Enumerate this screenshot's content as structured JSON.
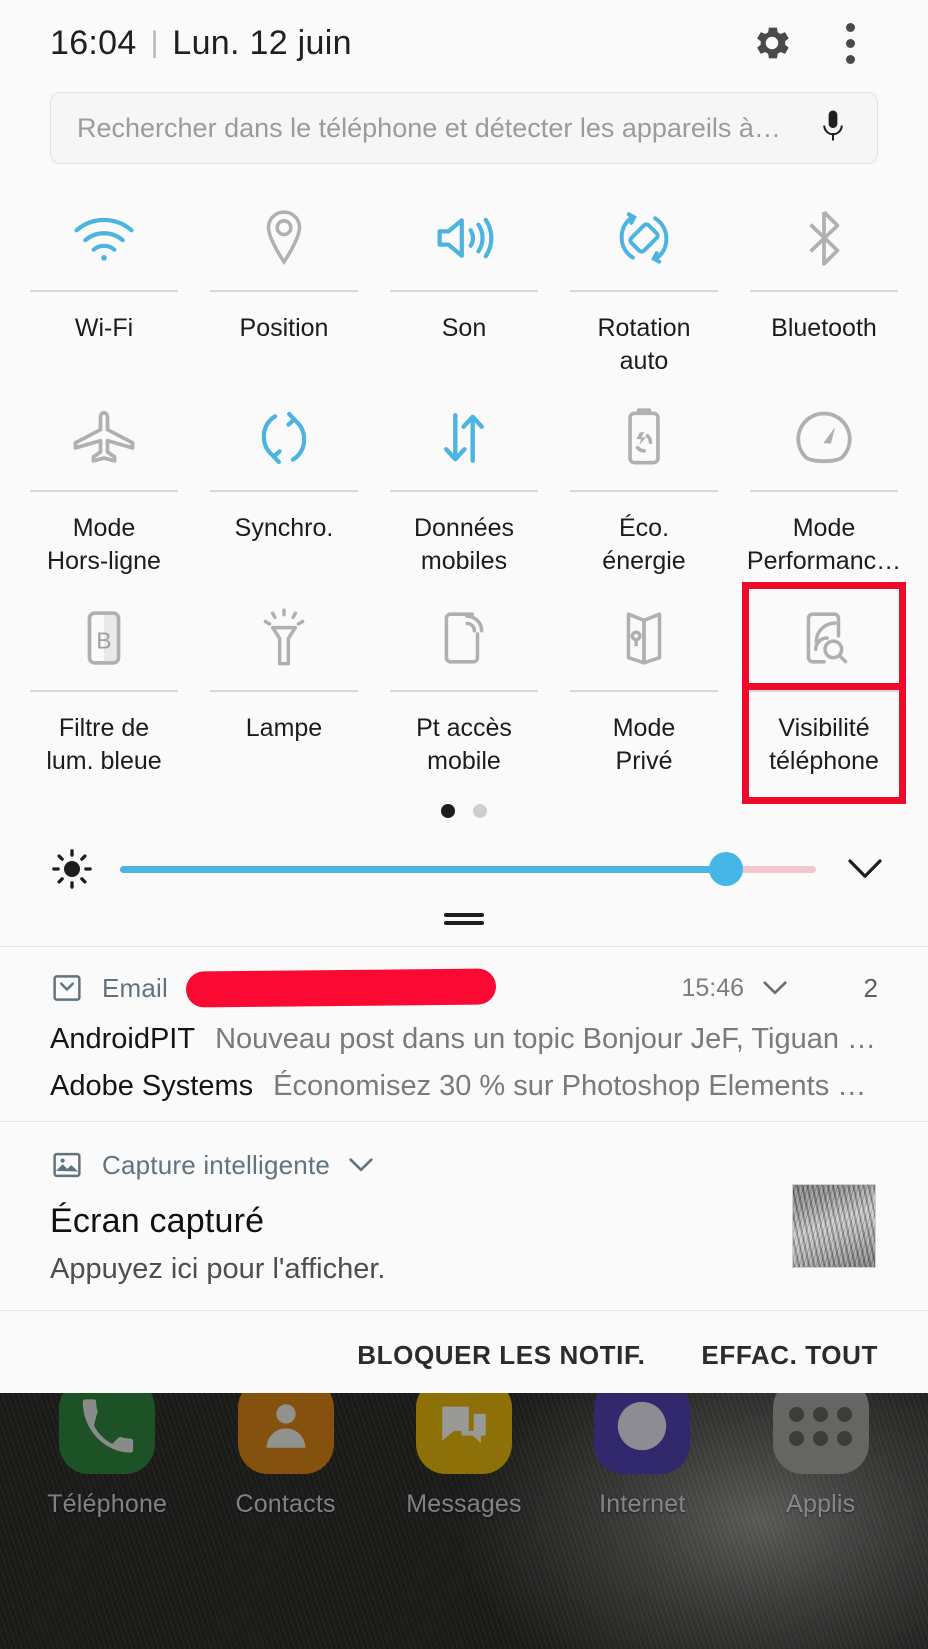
{
  "status": {
    "time": "16:04",
    "separator": "|",
    "date": "Lun. 12 juin",
    "settings_icon": "gear-icon",
    "overflow_icon": "kebab-menu-icon"
  },
  "search": {
    "placeholder": "Rechercher dans le téléphone et détecter les appareils à…",
    "mic_icon": "microphone-icon"
  },
  "quick_settings": {
    "accent_on": "#4db3e0",
    "accent_off": "#b0b0b0",
    "rows": [
      [
        {
          "label": "Wi-Fi",
          "icon": "wifi-icon",
          "active": true
        },
        {
          "label": "Position",
          "icon": "location-pin-icon",
          "active": false
        },
        {
          "label": "Son",
          "icon": "volume-speaker-icon",
          "active": true
        },
        {
          "label": "Rotation\nauto",
          "icon": "auto-rotate-icon",
          "active": true
        },
        {
          "label": "Bluetooth",
          "icon": "bluetooth-icon",
          "active": false
        }
      ],
      [
        {
          "label": "Mode\nHors-ligne",
          "icon": "airplane-icon",
          "active": false
        },
        {
          "label": "Synchro.",
          "icon": "sync-icon",
          "active": true
        },
        {
          "label": "Données\nmobiles",
          "icon": "data-arrows-icon",
          "active": true
        },
        {
          "label": "Éco.\nénergie",
          "icon": "battery-saver-icon",
          "active": false
        },
        {
          "label": "Mode\nPerformanc…",
          "icon": "performance-gauge-icon",
          "active": false
        }
      ],
      [
        {
          "label": "Filtre de\nlum. bleue",
          "icon": "blue-light-filter-icon",
          "active": false
        },
        {
          "label": "Lampe",
          "icon": "flashlight-icon",
          "active": false
        },
        {
          "label": "Pt accès\nmobile",
          "icon": "mobile-hotspot-icon",
          "active": false
        },
        {
          "label": "Mode\nPrivé",
          "icon": "private-mode-icon",
          "active": false
        },
        {
          "label": "Visibilité\ntéléphone",
          "icon": "phone-visibility-icon",
          "active": false,
          "highlighted": true
        }
      ]
    ],
    "pages": {
      "total": 2,
      "current": 1
    }
  },
  "brightness": {
    "icon": "brightness-icon",
    "value_percent": 87,
    "expand_icon": "chevron-down-icon",
    "fill_color": "#4db3e0",
    "track_color": "#f3c7ce"
  },
  "annotation": {
    "color": "#ee0a2a",
    "target": "Visibilité téléphone"
  },
  "notifications": {
    "email_group": {
      "app_name": "Email",
      "app_icon": "email-icon",
      "redacted": true,
      "time": "15:46",
      "chevron_icon": "chevron-down-icon",
      "count": "2",
      "items": [
        {
          "sender": "AndroidPIT",
          "text": "Nouveau post dans un topic Bonjour JeF, Tiguan a…"
        },
        {
          "sender": "Adobe Systems",
          "text": "Économisez 30 % sur Photoshop Elements et…"
        }
      ]
    },
    "capture_card": {
      "app_name": "Capture intelligente",
      "app_icon": "image-icon",
      "chevron_icon": "chevron-down-icon",
      "title": "Écran capturé",
      "subtitle": "Appuyez ici pour l'afficher.",
      "thumbnail": "screenshot-thumbnail"
    }
  },
  "actions": {
    "block": "BLOQUER LES NOTIF.",
    "clear_all": "EFFAC. TOUT"
  },
  "dock": {
    "apps": [
      {
        "label": "Téléphone",
        "icon": "phone-app-icon",
        "color": "#2d7d3a"
      },
      {
        "label": "Contacts",
        "icon": "contacts-app-icon",
        "color": "#c97d16"
      },
      {
        "label": "Messages",
        "icon": "messages-app-icon",
        "color": "#d6ab0d"
      },
      {
        "label": "Internet",
        "icon": "internet-app-icon",
        "color": "#4b3ea8"
      },
      {
        "label": "Applis",
        "icon": "app-drawer-icon",
        "color": "#9a9a97"
      }
    ]
  }
}
